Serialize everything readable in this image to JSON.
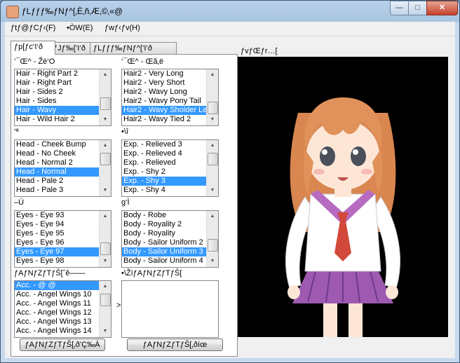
{
  "window": {
    "title": "ƒLƒƒƒ‰ƒNƒ^[ƒ‚ƒfƒ‹ƒGƒfƒBƒ^",
    "title_display": "ƒLƒƒƒ‰ƒNƒ^[‚È‚ñ‚Æ‚©‚«@",
    "controls": {
      "minimize": "—",
      "maximize": "□",
      "close": "✕"
    }
  },
  "menubar": {
    "items": [
      "ƒtƒ@ƒCƒ‹(F)",
      "•ÒW(E)",
      "ƒwƒ‹ƒv(H)"
    ]
  },
  "tabs": [
    "ƒp[ƒc‘I‘ð",
    "ƒJƒ‰[‘I‘ð",
    "ƒLƒƒƒ‰ƒNƒ^[‘I‘ð"
  ],
  "groups": {
    "hair_front": {
      "label": "‘¯Œ^ - Žè‘O",
      "items": [
        "Hair - Right Part 2",
        "Hair - Right Part",
        "Hair - Sides 2",
        "Hair - Sides",
        "Hair - Wavy",
        "Hair - Wild Hair 2"
      ],
      "selected": 4
    },
    "hair_back": {
      "label": "‘¯Œ^ - Œã‚ë",
      "items": [
        "Hair2 - Very Long",
        "Hair2 - Very Short",
        "Hair2 - Wavy Long",
        "Hair2 - Wavy Pony Tail",
        "Hair2 - Wavy Sholder Length",
        "Hair2 - Wavy Tied 2"
      ],
      "selected": 4
    },
    "head": {
      "label": "‘ª",
      "items": [
        "Head - Cheek Bump",
        "Head - No Cheek",
        "Head - Normal 2",
        "Head - Normal",
        "Head - Pale 2",
        "Head - Pale 3"
      ],
      "selected": 3
    },
    "expression": {
      "label": "•\\î",
      "items": [
        "Exp. - Relieved 3",
        "Exp. - Relieved 4",
        "Exp. - Relieved",
        "Exp. - Shy 2",
        "Exp. - Shy 3",
        "Exp. - Shy 4"
      ],
      "selected": 4
    },
    "eyes": {
      "label": "–Ú",
      "items": [
        "Eyes - Eye 93",
        "Eyes - Eye 94",
        "Eyes - Eye 95",
        "Eyes - Eye 96",
        "Eyes - Eye 97",
        "Eyes - Eye 98"
      ],
      "selected": 4
    },
    "body": {
      "label": "g‘Ì",
      "items": [
        "Body - Robe",
        "Body - Royality 2",
        "Body - Royality",
        "Body - Sailor Uniform 2",
        "Body - Sailor Uniform 3",
        "Body - Sailor Uniform 4"
      ],
      "selected": 4
    },
    "accessory_list": {
      "label": "ƒAƒNƒZƒTƒŠ[ˆê——",
      "items": [
        "Acc. - @ @",
        "Acc. - Angel Wings 10",
        "Acc. - Angel Wings 11",
        "Acc. - Angel Wings 12",
        "Acc. - Angel Wings 13",
        "Acc. - Angel Wings 14"
      ],
      "selected": 0
    },
    "accessory_equipped": {
      "label": "•\\ŽìƒAƒNƒZƒTƒŠ[",
      "items": []
    }
  },
  "arrow_between": ">",
  "buttons": {
    "add_accessory": "ƒAƒNƒZƒTƒŠ[‚ð’Ç‰Á",
    "remove_accessory": "ƒAƒNƒZƒTƒŠ[‚ðíœ"
  },
  "preview": {
    "label": "ƒvƒŒƒr…["
  },
  "colors": {
    "selection": "#3399ff",
    "preview_bg": "#000000",
    "hair": "#e0925a",
    "uniform_collar": "#b76bc0",
    "tie": "#d2483a",
    "skirt": "#9e5ab0"
  }
}
